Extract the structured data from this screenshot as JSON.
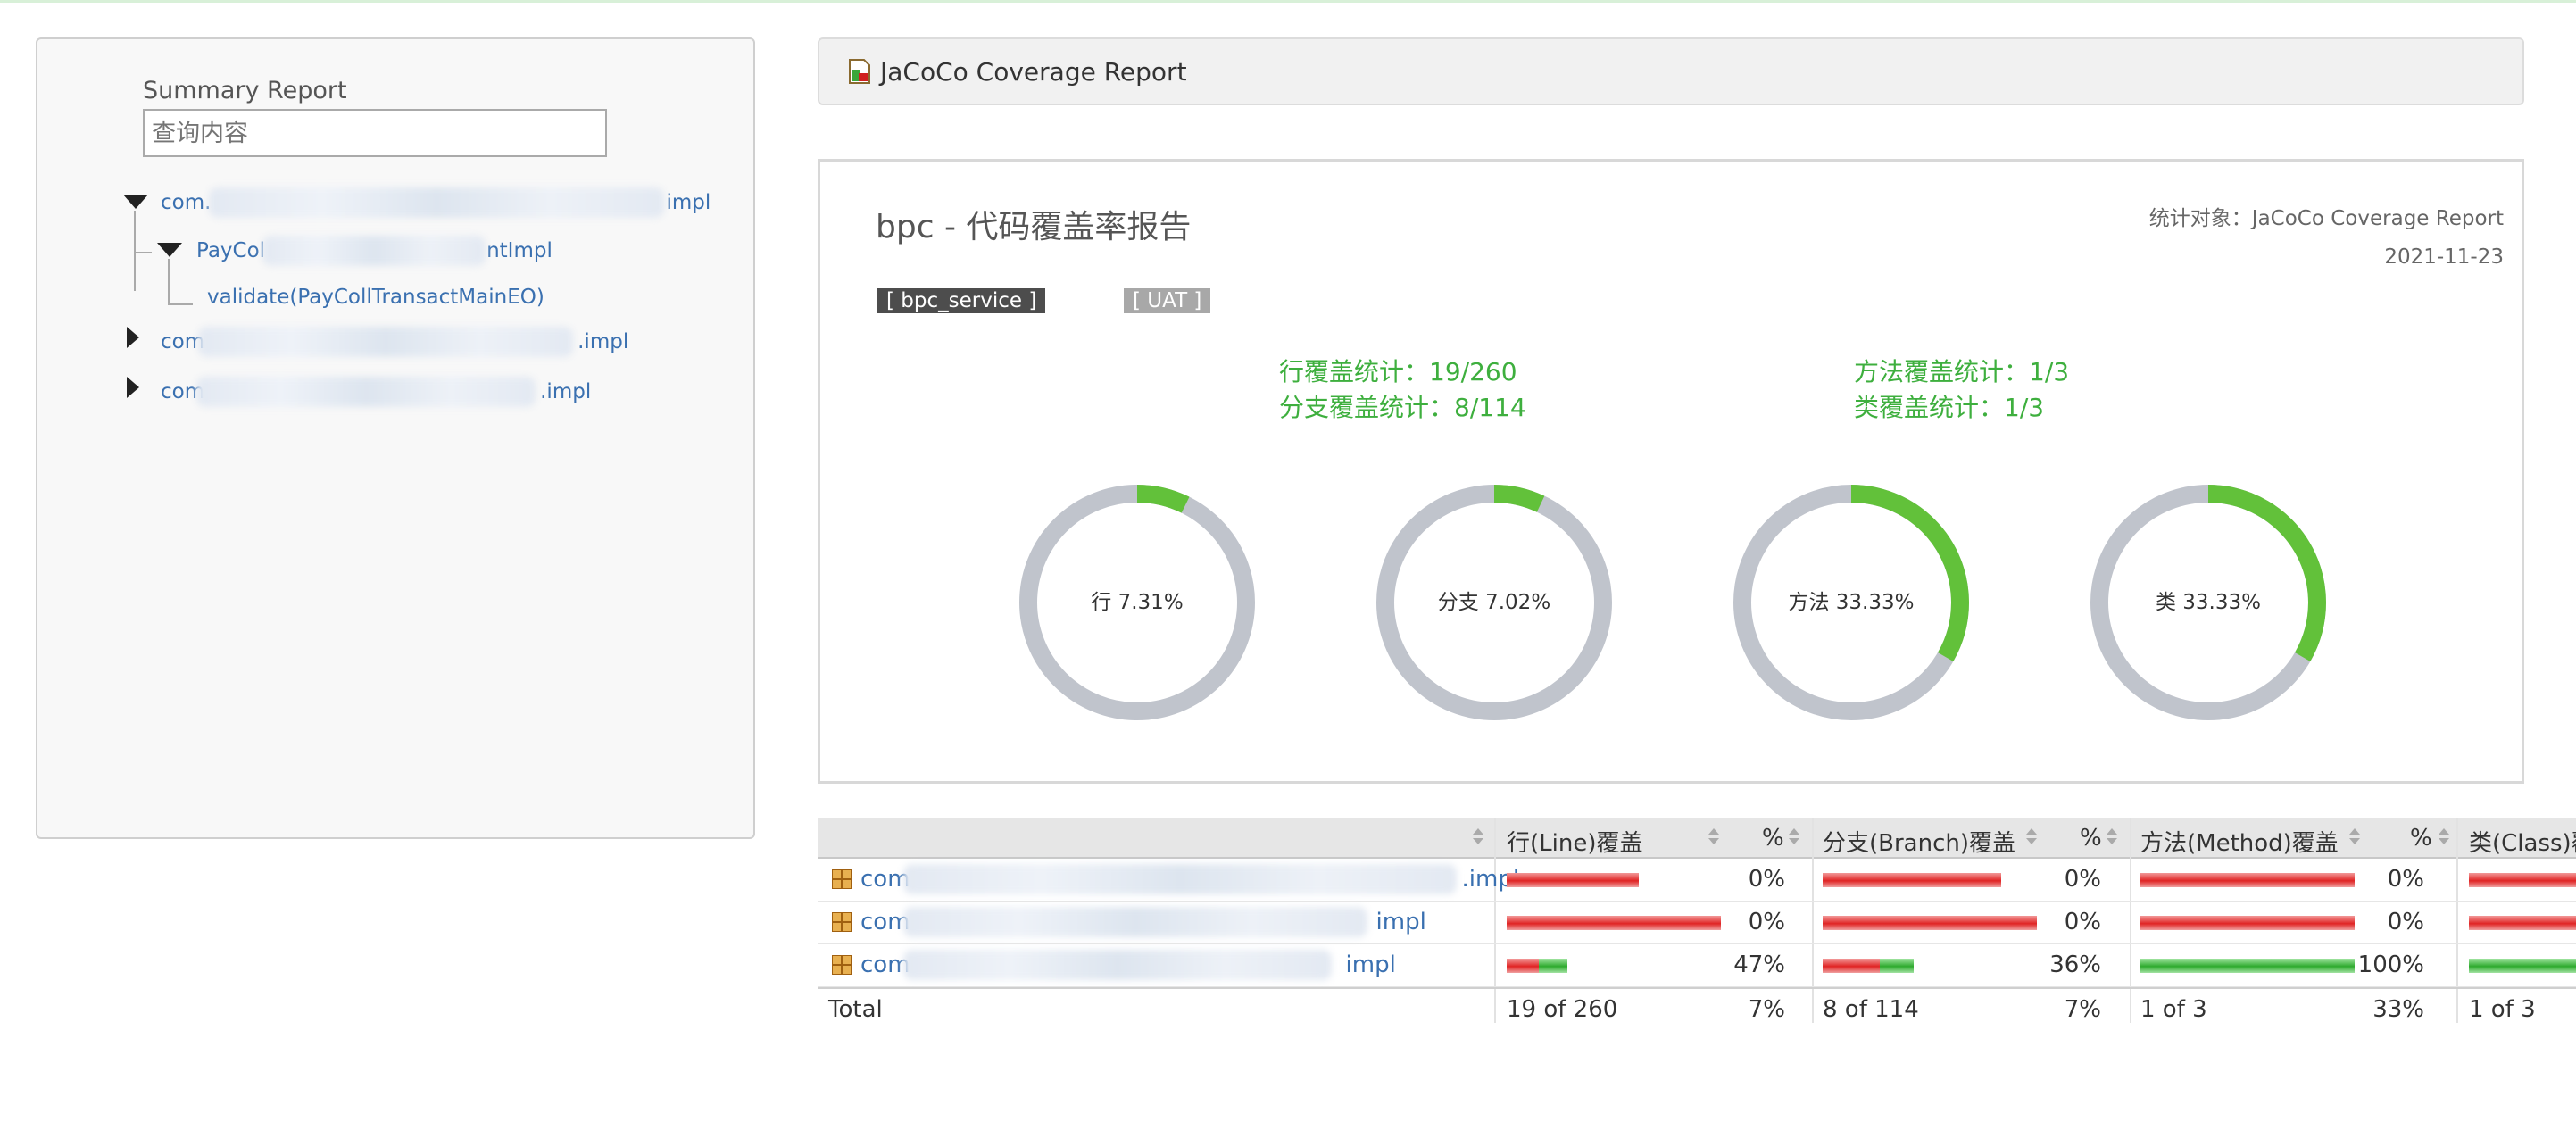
{
  "sidebar": {
    "title": "Summary Report",
    "search_placeholder": "查询内容",
    "tree": [
      {
        "prefix": "com.",
        "suffix": "impl"
      },
      {
        "prefix": "PayCol",
        "suffix": "ntImpl"
      },
      {
        "label": "validate(PayCollTransactMainEO)"
      },
      {
        "prefix": "com",
        "suffix": ".impl"
      },
      {
        "prefix": "com",
        "suffix": ".impl"
      }
    ]
  },
  "header": {
    "title": "JaCoCo Coverage Report"
  },
  "report": {
    "title": "bpc - 代码覆盖率报告",
    "target": "统计对象：JaCoCo Coverage Report",
    "date": "2021-11-23",
    "tags": [
      "[ bpc_service ]",
      "[ UAT ]"
    ],
    "stats": {
      "line": "行覆盖统计：19/260",
      "branch": "分支覆盖统计：8/114",
      "method": "方法覆盖统计：1/3",
      "class": "类覆盖统计：1/3"
    },
    "donuts": [
      {
        "label": "行 7.31%",
        "percent": 7.31
      },
      {
        "label": "分支 7.02%",
        "percent": 7.02
      },
      {
        "label": "方法 33.33%",
        "percent": 33.33
      },
      {
        "label": "类 33.33%",
        "percent": 33.33
      }
    ],
    "colors": {
      "covered": "#62c13a",
      "missed": "#c0c4cc"
    }
  },
  "table": {
    "headers": [
      "行(Line)覆盖",
      "%",
      "分支(Branch)覆盖",
      "%",
      "方法(Method)覆盖",
      "%",
      "类(Class)覆"
    ],
    "rows": [
      {
        "prefix": "com",
        "suffix": ".impl",
        "line_pct": "0%",
        "branch_pct": "0%",
        "method_pct": "0%",
        "line_cov": 0,
        "branch_cov": 0,
        "method_cov": 0
      },
      {
        "prefix": "com",
        "suffix": "impl",
        "line_pct": "0%",
        "branch_pct": "0%",
        "method_pct": "0%",
        "line_cov": 0,
        "branch_cov": 0,
        "method_cov": 0
      },
      {
        "prefix": "com",
        "suffix": "impl",
        "line_pct": "47%",
        "branch_pct": "36%",
        "method_pct": "100%",
        "line_cov": 0.47,
        "branch_cov": 0.36,
        "method_cov": 1.0
      }
    ],
    "total": {
      "label": "Total",
      "line": "19 of 260",
      "line_pct": "7%",
      "branch": "8 of 114",
      "branch_pct": "7%",
      "method": "1 of 3",
      "method_pct": "33%",
      "class": "1 of 3"
    }
  }
}
